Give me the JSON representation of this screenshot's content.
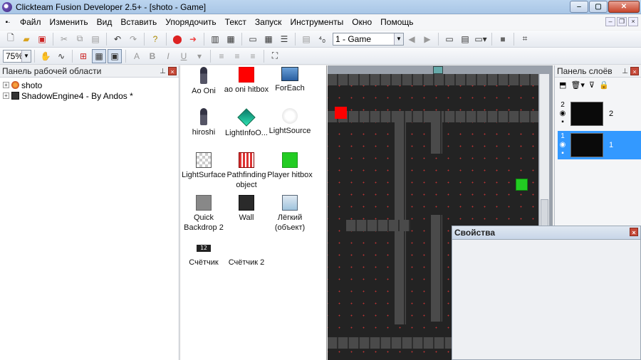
{
  "window": {
    "title": "Clickteam Fusion Developer 2.5+ - [shoto - Game]",
    "min_label": "‒",
    "max_label": "▢",
    "close_label": "✕"
  },
  "menu": {
    "items": [
      "Файл",
      "Изменить",
      "Вид",
      "Вставить",
      "Упорядочить",
      "Текст",
      "Запуск",
      "Инструменты",
      "Окно",
      "Помощь"
    ]
  },
  "toolbar": {
    "frame_select": "1 - Game",
    "zoom": "75%"
  },
  "workspace": {
    "title": "Панель рабочей области",
    "tree": [
      {
        "label": "shoto",
        "icon": "app-icon"
      },
      {
        "label": "ShadowEngine4 - By Andos *",
        "icon": "film-icon"
      }
    ]
  },
  "objects": [
    {
      "label": "Ao Oni",
      "icon": "person-icon"
    },
    {
      "label": "ao oni hitbox",
      "icon": "red-square-icon"
    },
    {
      "label": "ForEach",
      "icon": "foreach-icon"
    },
    {
      "label": "hiroshi",
      "icon": "person-icon"
    },
    {
      "label": "LightInfoO...",
      "icon": "diamond-icon"
    },
    {
      "label": "LightSource",
      "icon": "glow-icon"
    },
    {
      "label": "LightSurface",
      "icon": "checker-icon"
    },
    {
      "label": "Pathfinding object",
      "icon": "pathfinding-icon"
    },
    {
      "label": "Player hitbox",
      "icon": "green-square-icon"
    },
    {
      "label": "Quick Backdrop 2",
      "icon": "gray-square-icon"
    },
    {
      "label": "Wall",
      "icon": "wall-icon"
    },
    {
      "label": "Лёгкий (объект)",
      "icon": "light-object-icon"
    },
    {
      "label": "Счётчик",
      "icon": "counter-icon",
      "counter_text": "12"
    },
    {
      "label": "Счётчик 2",
      "icon": "none"
    }
  ],
  "layers": {
    "title": "Панель слоёв",
    "rows": [
      {
        "number": "2",
        "name": "2",
        "selected": false
      },
      {
        "number": "1",
        "name": "1",
        "selected": true
      }
    ]
  },
  "properties": {
    "title": "Свойства"
  },
  "colors": {
    "selection": "#3399ff",
    "frame_bg": "#232323",
    "red_marker": "#ff0000",
    "green_marker": "#22cc22"
  }
}
